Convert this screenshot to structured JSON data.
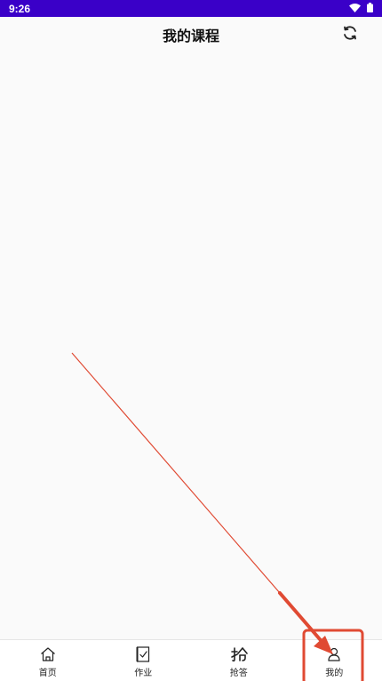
{
  "status_bar": {
    "time": "9:26",
    "background": "#3a00c8",
    "icons": [
      "wifi-icon",
      "battery-icon"
    ]
  },
  "header": {
    "title": "我的课程",
    "refresh_icon": "refresh-icon"
  },
  "tabs": [
    {
      "label": "首页",
      "icon": "home-icon"
    },
    {
      "label": "作业",
      "icon": "homework-icon"
    },
    {
      "label": "抢答",
      "icon": "quick-answer-icon"
    },
    {
      "label": "我的",
      "icon": "profile-icon"
    }
  ],
  "annotation": {
    "color": "#e04a33",
    "highlighted_tab": "我的"
  }
}
